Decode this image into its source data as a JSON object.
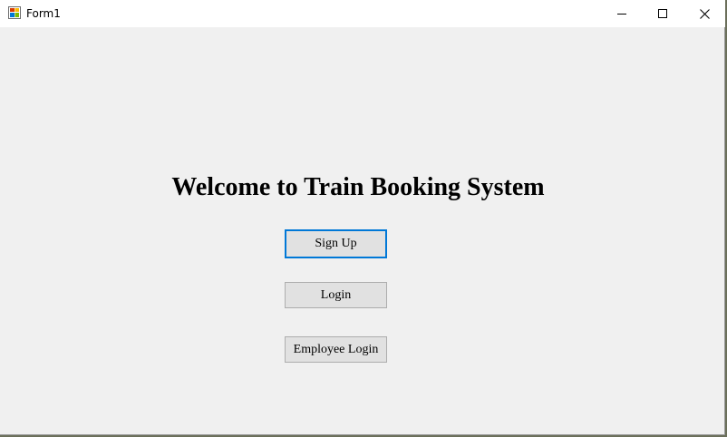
{
  "window": {
    "title": "Form1",
    "controls": {
      "minimize_icon": "minimize-icon",
      "maximize_icon": "maximize-icon",
      "close_icon": "close-icon"
    }
  },
  "main": {
    "heading": "Welcome to Train Booking System",
    "buttons": {
      "signup_label": "Sign Up",
      "login_label": "Login",
      "employee_login_label": "Employee Login"
    }
  },
  "colors": {
    "focus_border": "#0078d7",
    "button_face": "#e1e1e1",
    "form_background": "#f0f0f0"
  }
}
